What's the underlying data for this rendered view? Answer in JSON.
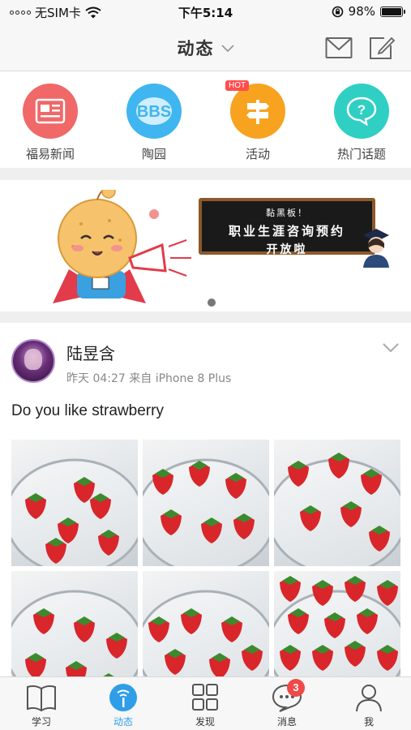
{
  "status_bar": {
    "carrier": "无SIM卡",
    "time": "下午5:14",
    "battery_percent": "98%",
    "battery_level": 0.98,
    "icons": [
      "signal-dots-icon",
      "wifi-icon",
      "orientation-lock-icon",
      "battery-icon"
    ]
  },
  "nav": {
    "title": "动态",
    "icons": [
      "chevron-down-icon",
      "mail-icon",
      "edit-icon"
    ]
  },
  "quick_menu": {
    "items": [
      {
        "label": "福易新闻",
        "icon": "news-icon",
        "color": "#f06868"
      },
      {
        "label": "陶园",
        "icon": "bbs-icon",
        "color": "#3fb6ef"
      },
      {
        "label": "活动",
        "icon": "signpost-icon",
        "color": "#f7a320",
        "tag": "HOT"
      },
      {
        "label": "热门话题",
        "icon": "chat-question-icon",
        "color": "#2fcfc4"
      }
    ]
  },
  "banner": {
    "board_line1": "黏黑板！",
    "board_line2": "职业生涯咨询预约",
    "board_line3": "开放啦",
    "slide_index": 1,
    "slide_count": 1
  },
  "post": {
    "author": "陆昱含",
    "meta": "昨天 04:27 来自 iPhone 8 Plus",
    "text": "Do you like strawberry",
    "photo_count": 6
  },
  "tab_bar": {
    "tabs": [
      {
        "label": "学习",
        "icon": "book-icon",
        "active": false
      },
      {
        "label": "动态",
        "icon": "feed-icon",
        "active": true
      },
      {
        "label": "发现",
        "icon": "grid-icon",
        "active": false
      },
      {
        "label": "消息",
        "icon": "message-icon",
        "active": false,
        "badge": "3"
      },
      {
        "label": "我",
        "icon": "person-icon",
        "active": false
      }
    ]
  },
  "colors": {
    "accent": "#2f9ee8",
    "badge": "#f24848",
    "strawberry": "#d8262b"
  }
}
